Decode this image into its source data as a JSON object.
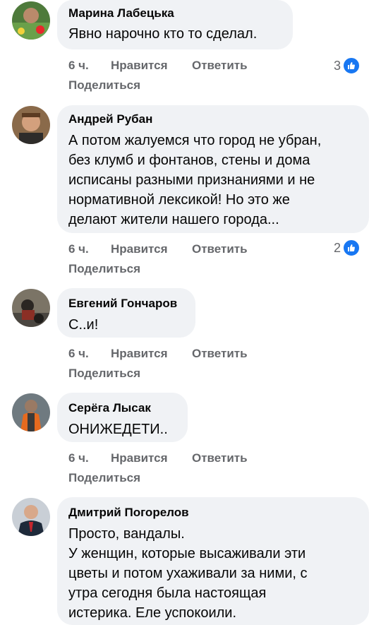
{
  "comments": [
    {
      "author": "Марина Лабецька",
      "text": "Явно нарочно кто то сделал.",
      "time": "6 ч.",
      "like": "Нравится",
      "reply": "Ответить",
      "share": "Поделиться",
      "reactions": "3"
    },
    {
      "author": "Андрей Рубан",
      "text": "А потом жалуемся что город не убран,\nбез клумб и фонтанов, стены и дома\nисписаны разными признаниями и не\nнормативной лексикой! Но это же\nделают жители нашего города...",
      "time": "6 ч.",
      "like": "Нравится",
      "reply": "Ответить",
      "share": "Поделиться",
      "reactions": "2"
    },
    {
      "author": "Евгений Гончаров",
      "text": "С..и!",
      "time": "6 ч.",
      "like": "Нравится",
      "reply": "Ответить",
      "share": "Поделиться"
    },
    {
      "author": "Серёга Лысак",
      "text": "ОНИЖЕДЕТИ..",
      "time": "6 ч.",
      "like": "Нравится",
      "reply": "Ответить",
      "share": "Поделиться"
    },
    {
      "author": "Дмитрий Погорелов",
      "text": "Просто, вандалы.\nУ женщин, которые высаживали эти\nцветы и потом ухаживали за ними, с\nутра сегодня была настоящая\nистерика. Еле успокоили."
    }
  ],
  "colors": {
    "bubble": "#f0f2f5",
    "secondary_text": "#65676b",
    "like_blue": "#1877f2"
  }
}
